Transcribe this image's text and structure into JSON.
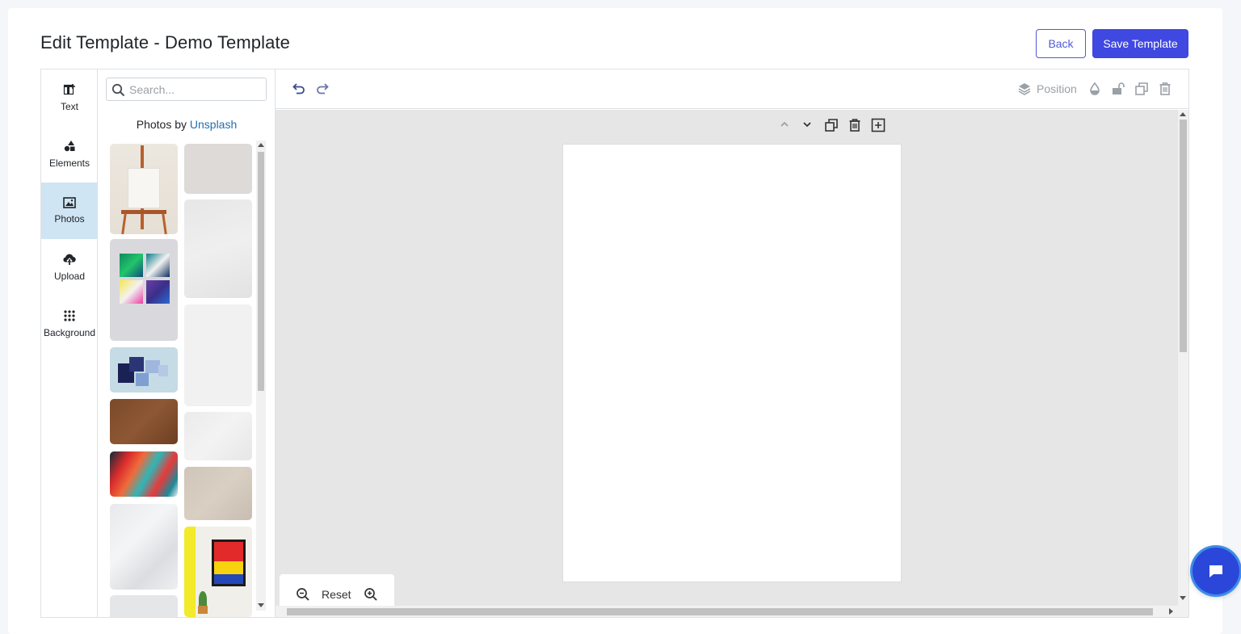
{
  "header": {
    "title": "Edit Template - Demo Template",
    "back_label": "Back",
    "save_label": "Save Template"
  },
  "sidebar": {
    "items": [
      {
        "label": "Text",
        "icon": "text-plus-icon"
      },
      {
        "label": "Elements",
        "icon": "shapes-icon"
      },
      {
        "label": "Photos",
        "icon": "image-icon",
        "active": true
      },
      {
        "label": "Upload",
        "icon": "cloud-upload-icon"
      },
      {
        "label": "Background",
        "icon": "dots-grid-icon"
      }
    ]
  },
  "photos_panel": {
    "search_placeholder": "Search...",
    "credit_prefix": "Photos by",
    "credit_link": "Unsplash"
  },
  "toolbar": {
    "position_label": "Position",
    "icons": [
      "undo-icon",
      "redo-icon",
      "layers-icon",
      "opacity-drop-icon",
      "unlock-icon",
      "duplicate-icon",
      "trash-icon"
    ]
  },
  "page_tools": {
    "icons": [
      "chevron-up-icon",
      "chevron-down-icon",
      "duplicate-page-icon",
      "delete-page-icon",
      "add-page-icon"
    ]
  },
  "zoom": {
    "reset_label": "Reset",
    "icons": [
      "zoom-out-icon",
      "zoom-in-icon"
    ]
  },
  "colors": {
    "primary": "#3f48e0",
    "active_tool_bg": "#cfe5f3",
    "link": "#1f6fb2",
    "workspace_bg": "#e6e6e6"
  }
}
